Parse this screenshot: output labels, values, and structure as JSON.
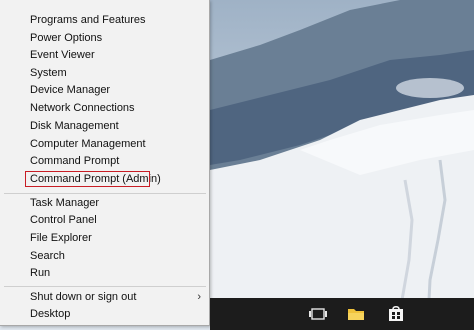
{
  "context_menu": {
    "items_group1": [
      {
        "label": "Programs and Features"
      },
      {
        "label": "Power Options"
      },
      {
        "label": "Event Viewer"
      },
      {
        "label": "System"
      },
      {
        "label": "Device Manager"
      },
      {
        "label": "Network Connections"
      },
      {
        "label": "Disk Management"
      },
      {
        "label": "Computer Management"
      },
      {
        "label": "Command Prompt"
      },
      {
        "label": "Command Prompt (Admin)"
      }
    ],
    "items_group2": [
      {
        "label": "Task Manager"
      },
      {
        "label": "Control Panel"
      },
      {
        "label": "File Explorer"
      },
      {
        "label": "Search"
      },
      {
        "label": "Run"
      }
    ],
    "items_group3": [
      {
        "label": "Shut down or sign out"
      },
      {
        "label": "Desktop"
      }
    ],
    "highlight_color": "#c81d25"
  },
  "taskbar": {
    "icons": [
      "task-view-icon",
      "file-explorer-icon",
      "store-icon"
    ]
  }
}
